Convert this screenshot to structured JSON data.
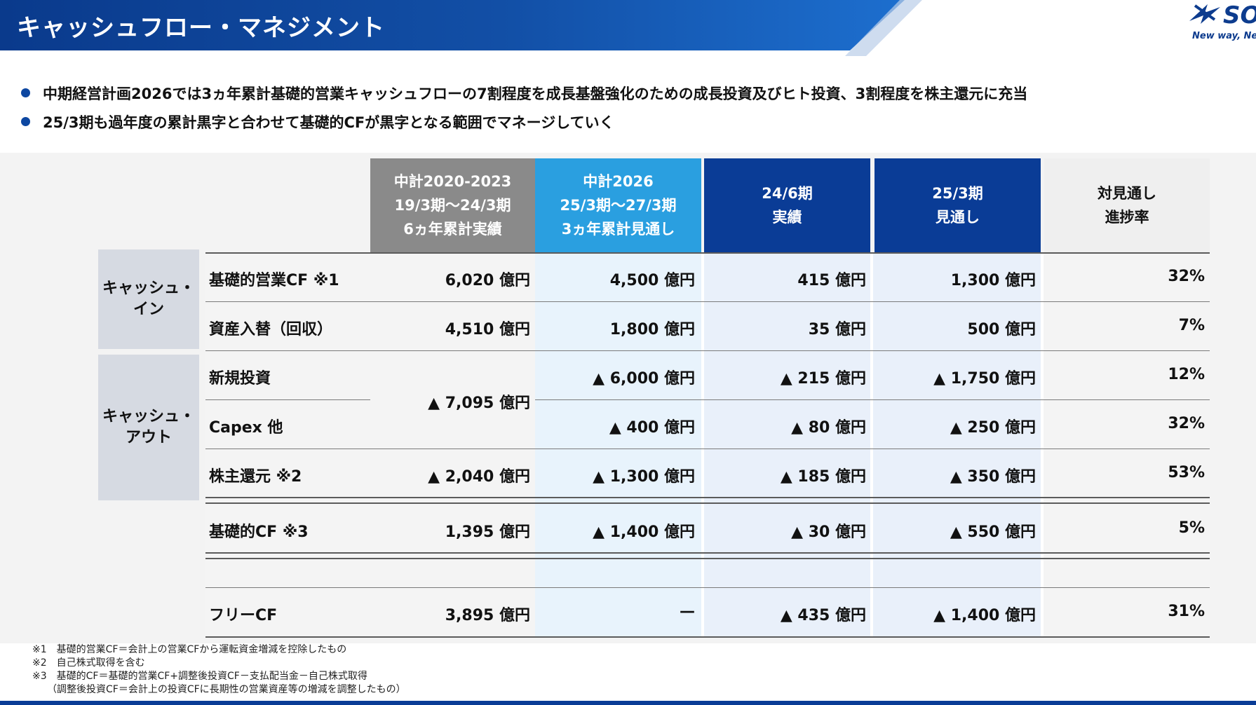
{
  "header": {
    "title": "キャッシュフロー・マネジメント"
  },
  "logo": {
    "word": "SO",
    "tagline": "New way, Ne"
  },
  "bullets": [
    "中期経営計画2026では3ヵ年累計基礎的営業キャッシュフローの7割程度を成長基盤強化のための成長投資及びヒト投資、3割程度を株主還元に充当",
    "25/3期も過年度の累計黒字と合わせて基礎的CFが黒字となる範囲でマネージしていく"
  ],
  "table": {
    "columns": [
      {
        "lines": [
          "中計2020-2023",
          "19/3期～24/3期",
          "6ヵ年累計実績"
        ]
      },
      {
        "lines": [
          "中計2026",
          "25/3期～27/3期",
          "3ヵ年累計見通し"
        ]
      },
      {
        "lines": [
          "24/6期",
          "実績"
        ]
      },
      {
        "lines": [
          "25/3期",
          "見通し"
        ]
      },
      {
        "lines": [
          "対見通し",
          "進捗率"
        ]
      }
    ],
    "groups": {
      "cash_in": [
        "キャッシュ・",
        "イン"
      ],
      "cash_out": [
        "キャッシュ・",
        "アウト"
      ]
    },
    "rows": [
      {
        "label": "基礎的営業CF ※1",
        "values": [
          "6,020 億円",
          "4,500 億円",
          "415 億円",
          "1,300 億円",
          "32%"
        ]
      },
      {
        "label": "資産入替（回収）",
        "values": [
          "4,510 億円",
          "1,800 億円",
          "35 億円",
          "500 億円",
          "7%"
        ]
      },
      {
        "label": "新規投資",
        "values": [
          "",
          "▲ 6,000 億円",
          "▲ 215 億円",
          "▲ 1,750 億円",
          "12%"
        ]
      },
      {
        "label": "Capex 他",
        "values": [
          "",
          "▲ 400 億円",
          "▲ 80 億円",
          "▲ 250 億円",
          "32%"
        ]
      },
      {
        "label": "株主還元 ※2",
        "values": [
          "▲ 2,040 億円",
          "▲ 1,300 億円",
          "▲ 185 億円",
          "▲ 350 億円",
          "53%"
        ]
      },
      {
        "label": "基礎的CF ※3",
        "values": [
          "1,395 億円",
          "▲ 1,400 億円",
          "▲ 30 億円",
          "▲ 550 億円",
          "5%"
        ]
      },
      {
        "label": "フリーCF",
        "values": [
          "3,895 億円",
          "—",
          "▲ 435 億円",
          "▲ 1,400 億円",
          "31%"
        ]
      }
    ],
    "merged_investment": "▲ 7,095 億円"
  },
  "footnotes": [
    "※1　基礎的営業CF＝会計上の営業CFから運転資金増減を控除したもの",
    "※2　自己株式取得を含む",
    "※3　基礎的CF＝基礎的営業CF+調整後投資CF－支払配当金－自己株式取得",
    "　　（調整後投資CF＝会計上の投資CFに長期性の営業資産等の増減を調整したもの）"
  ],
  "colors": {
    "navy": "#0a3c96",
    "cyan": "#2a9fe0",
    "gray": "#8a8a8a"
  }
}
